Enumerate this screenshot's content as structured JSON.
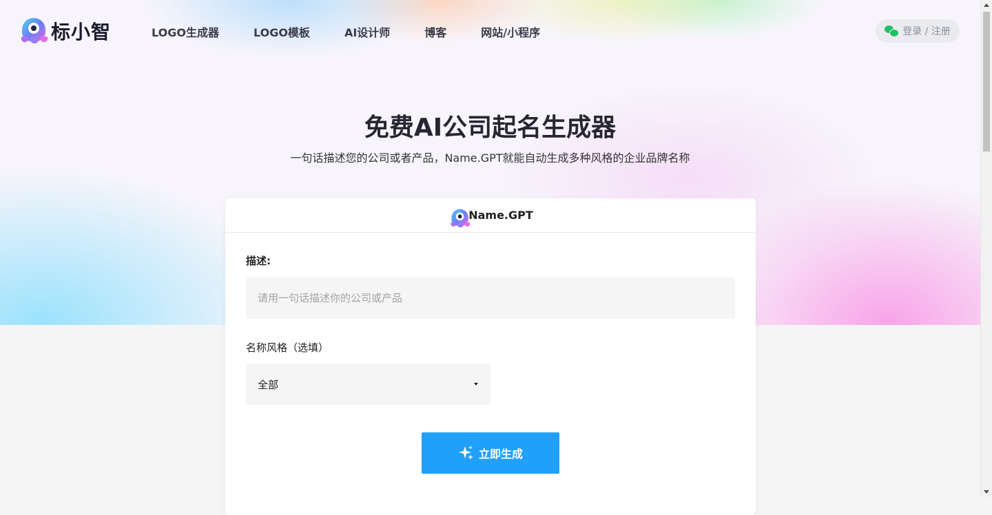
{
  "header": {
    "logo_text": "标小智",
    "nav": [
      "LOGO生成器",
      "LOGO模板",
      "AI设计师",
      "博客",
      "网站/小程序"
    ],
    "login_label": "登录 / 注册"
  },
  "hero": {
    "title": "免费AI公司起名生成器",
    "subtitle": "一句话描述您的公司或者产品，Name.GPT就能自动生成多种风格的企业品牌名称"
  },
  "card": {
    "title": "Name.GPT",
    "description_label": "描述:",
    "description_placeholder": "请用一句话描述你的公司或产品",
    "description_value": "",
    "style_label": "名称风格（选填）",
    "style_selected": "全部",
    "generate_label": "立即生成"
  },
  "icons": {
    "logo": "mascot-logo-icon",
    "login": "wechat-icon",
    "dropdown": "caret-down-icon",
    "generate": "sparkle-icon"
  },
  "colors": {
    "accent": "#21a0fa",
    "wechat": "#20c064",
    "title": "#262633"
  }
}
